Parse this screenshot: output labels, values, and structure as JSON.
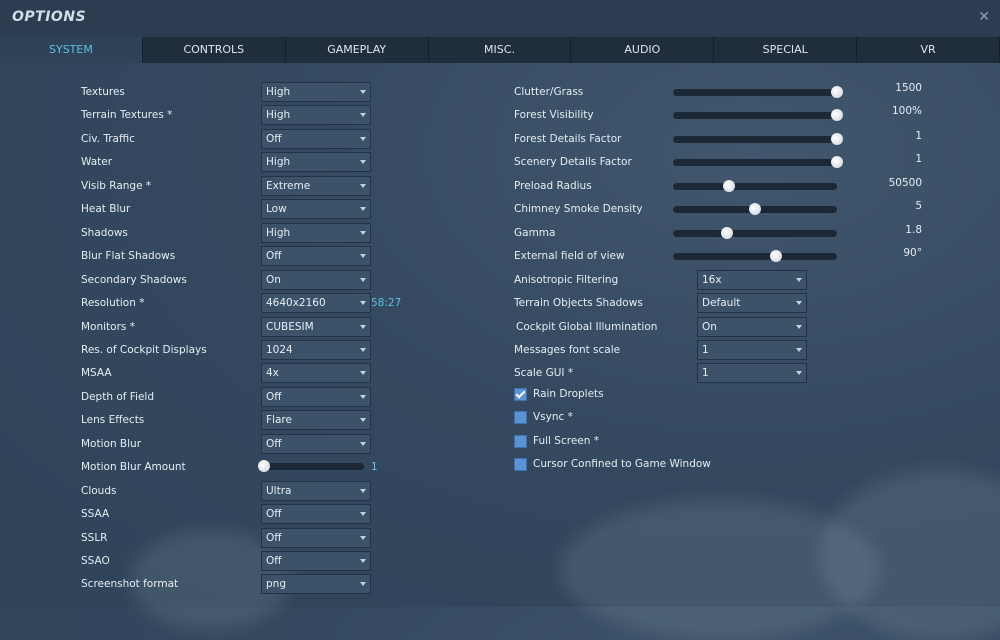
{
  "window": {
    "title": "OPTIONS",
    "close_icon": "close-icon"
  },
  "tabs": [
    {
      "label": "SYSTEM",
      "active": true
    },
    {
      "label": "CONTROLS"
    },
    {
      "label": "GAMEPLAY"
    },
    {
      "label": "MISC."
    },
    {
      "label": "AUDIO"
    },
    {
      "label": "SPECIAL"
    },
    {
      "label": "VR"
    }
  ],
  "left": [
    {
      "label": "Textures",
      "type": "dropdown",
      "value": "High"
    },
    {
      "label": "Terrain Textures *",
      "type": "dropdown",
      "value": "High"
    },
    {
      "label": "Civ. Traffic",
      "type": "dropdown",
      "value": "Off"
    },
    {
      "label": "Water",
      "type": "dropdown",
      "value": "High"
    },
    {
      "label": "Visib Range *",
      "type": "dropdown",
      "value": "Extreme"
    },
    {
      "label": "Heat Blur",
      "type": "dropdown",
      "value": "Low"
    },
    {
      "label": "Shadows",
      "type": "dropdown",
      "value": "High"
    },
    {
      "label": "Blur Flat Shadows",
      "type": "dropdown",
      "value": "Off"
    },
    {
      "label": "Secondary Shadows",
      "type": "dropdown",
      "value": "On"
    },
    {
      "label": "Resolution *",
      "type": "dropdown",
      "value": "4640x2160",
      "hint": "58:27"
    },
    {
      "label": "Monitors *",
      "type": "dropdown",
      "value": "CUBESIM"
    },
    {
      "label": "Res. of Cockpit Displays",
      "type": "dropdown",
      "value": "1024"
    },
    {
      "label": "MSAA",
      "type": "dropdown",
      "value": "4x"
    },
    {
      "label": "Depth of Field",
      "type": "dropdown",
      "value": "Off"
    },
    {
      "label": "Lens Effects",
      "type": "dropdown",
      "value": "Flare"
    },
    {
      "label": "Motion Blur",
      "type": "dropdown",
      "value": "Off"
    },
    {
      "label": "Motion Blur Amount",
      "type": "slider",
      "fraction": 0,
      "hint": "1"
    },
    {
      "label": "Clouds",
      "type": "dropdown",
      "value": "Ultra"
    },
    {
      "label": "SSAA",
      "type": "dropdown",
      "value": "Off"
    },
    {
      "label": "SSLR",
      "type": "dropdown",
      "value": "Off"
    },
    {
      "label": "SSAO",
      "type": "dropdown",
      "value": "Off"
    },
    {
      "label": "Screenshot format",
      "type": "dropdown",
      "value": "png"
    }
  ],
  "right_sliders": [
    {
      "label": "Clutter/Grass",
      "fraction": 1.0,
      "value": "1500"
    },
    {
      "label": "Forest Visibility",
      "fraction": 1.0,
      "value": "100%"
    },
    {
      "label": "Forest Details Factor",
      "fraction": 1.0,
      "value": "1"
    },
    {
      "label": "Scenery Details Factor",
      "fraction": 1.0,
      "value": "1"
    },
    {
      "label": "Preload Radius",
      "fraction": 0.34,
      "value": "50500"
    },
    {
      "label": "Chimney Smoke Density",
      "fraction": 0.5,
      "value": "5"
    },
    {
      "label": "Gamma",
      "fraction": 0.33,
      "value": "1.8"
    },
    {
      "label": "External field of view",
      "fraction": 0.63,
      "value": "90°"
    }
  ],
  "right_dropdowns": [
    {
      "label": "Anisotropic Filtering",
      "value": "16x"
    },
    {
      "label": "Terrain Objects Shadows",
      "value": "Default"
    },
    {
      "label": "Cockpit Global Illumination",
      "value": "On"
    },
    {
      "label": "Messages font scale",
      "value": "1"
    },
    {
      "label": "Scale GUI *",
      "value": "1"
    }
  ],
  "checkboxes": [
    {
      "label": "Rain Droplets",
      "checked": true
    },
    {
      "label": "Vsync *",
      "checked": false
    },
    {
      "label": "Full Screen *",
      "checked": false
    },
    {
      "label": "Cursor Confined to Game Window",
      "checked": false
    }
  ]
}
